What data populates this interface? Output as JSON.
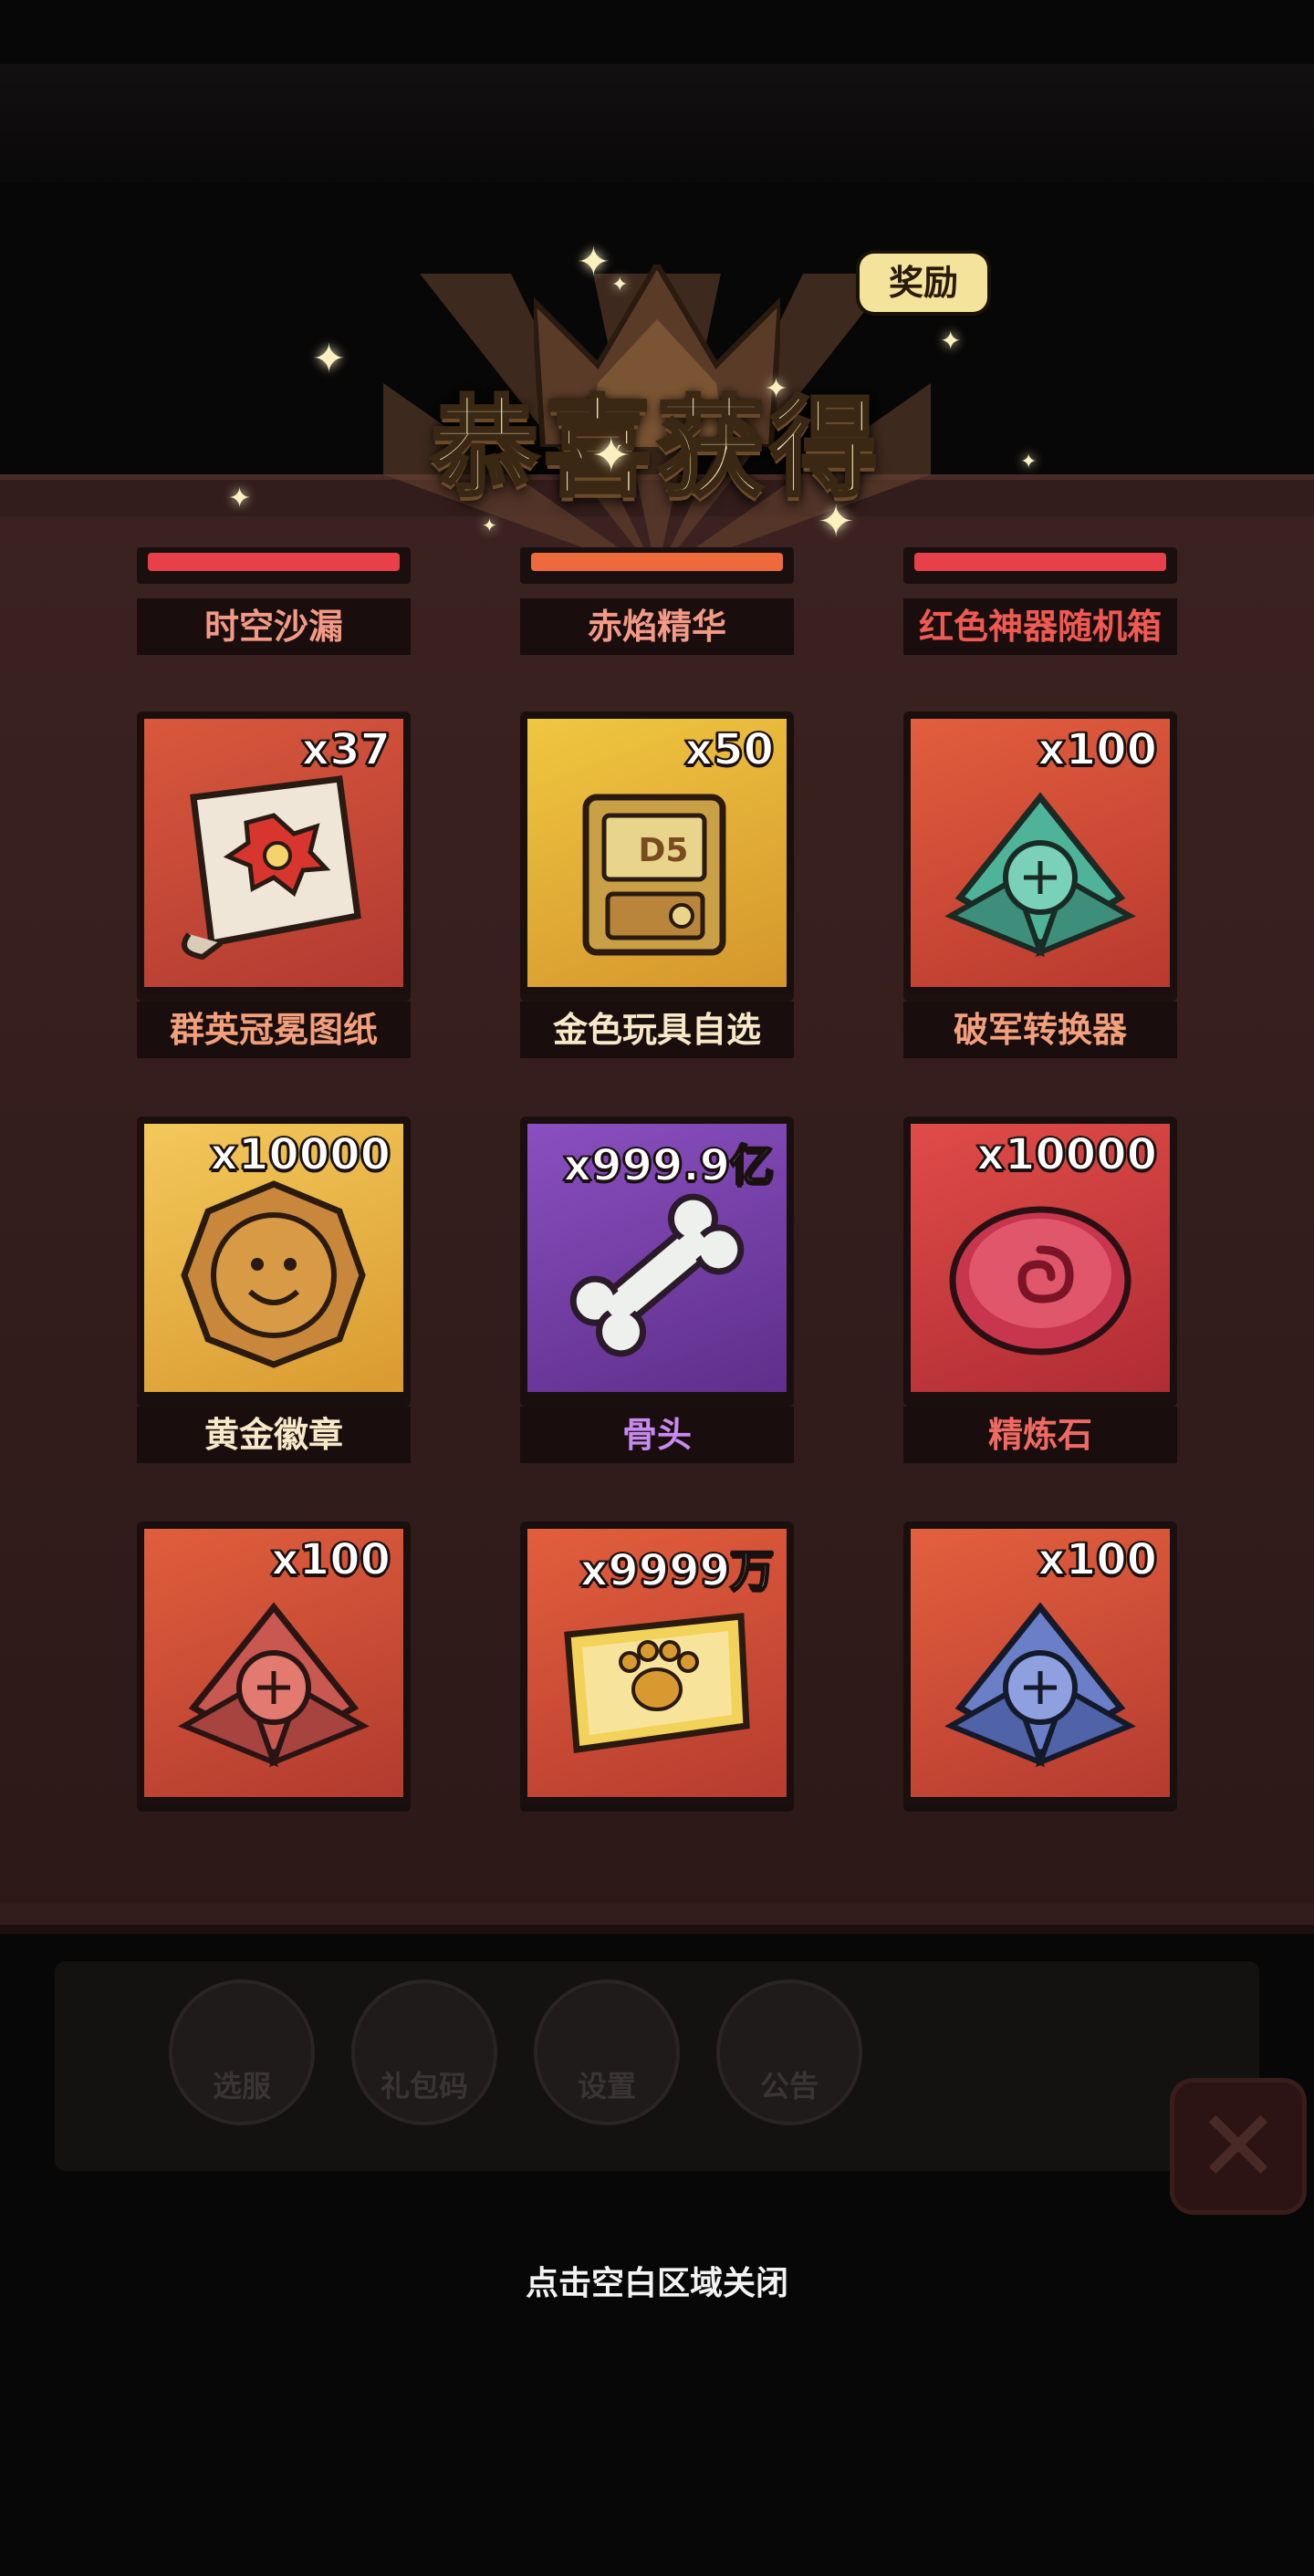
{
  "header": {
    "title": "恭喜获得",
    "badge": "奖励",
    "accent_color": "#f6e3b2"
  },
  "partial_row": [
    {
      "label": "时空沙漏",
      "label_color": "#f29a86",
      "rarity_color": "#e8404a"
    },
    {
      "label": "赤焰精华",
      "label_color": "#f29a86",
      "rarity_color": "#ee6a3c"
    },
    {
      "label": "红色神器随机箱",
      "label_color": "#ef5a52",
      "rarity_color": "#e8404a"
    }
  ],
  "rewards": [
    {
      "name": "群英冠冕图纸",
      "quantity": "x37",
      "icon": "scroll-blueprint-icon",
      "rarity": "orange",
      "label_color": "#f2a07c"
    },
    {
      "name": "金色玩具自选",
      "quantity": "x50",
      "icon": "golden-toy-box-icon",
      "rarity": "gold",
      "label_color": "#f7e9c8"
    },
    {
      "name": "破军转换器",
      "quantity": "x100",
      "icon": "teal-converter-icon",
      "rarity": "orange",
      "label_color": "#f2a07c"
    },
    {
      "name": "黄金徽章",
      "quantity": "x10000",
      "icon": "gold-badge-icon",
      "rarity": "gold",
      "label_color": "#f7e9c8"
    },
    {
      "name": "骨头",
      "quantity": "x999.9亿",
      "icon": "bone-icon",
      "rarity": "purple",
      "label_color": "#c78af0"
    },
    {
      "name": "精炼石",
      "quantity": "x10000",
      "icon": "refine-stone-icon",
      "rarity": "red",
      "label_color": "#ef6a62"
    },
    {
      "name": "",
      "quantity": "x100",
      "icon": "red-converter-icon",
      "rarity": "orange",
      "label_color": "#f2a07c"
    },
    {
      "name": "",
      "quantity": "x9999万",
      "icon": "paw-ticket-icon",
      "rarity": "orange",
      "label_color": "#f2a07c"
    },
    {
      "name": "",
      "quantity": "x100",
      "icon": "blue-converter-icon",
      "rarity": "orange",
      "label_color": "#f2a07c"
    }
  ],
  "background_buttons": [
    {
      "label": "选服",
      "icon": "server-select-icon"
    },
    {
      "label": "礼包码",
      "icon": "gift-code-icon"
    },
    {
      "label": "设置",
      "icon": "settings-gear-icon"
    },
    {
      "label": "公告",
      "icon": "announcement-icon"
    }
  ],
  "footer": {
    "close_hint": "点击空白区域关闭"
  }
}
